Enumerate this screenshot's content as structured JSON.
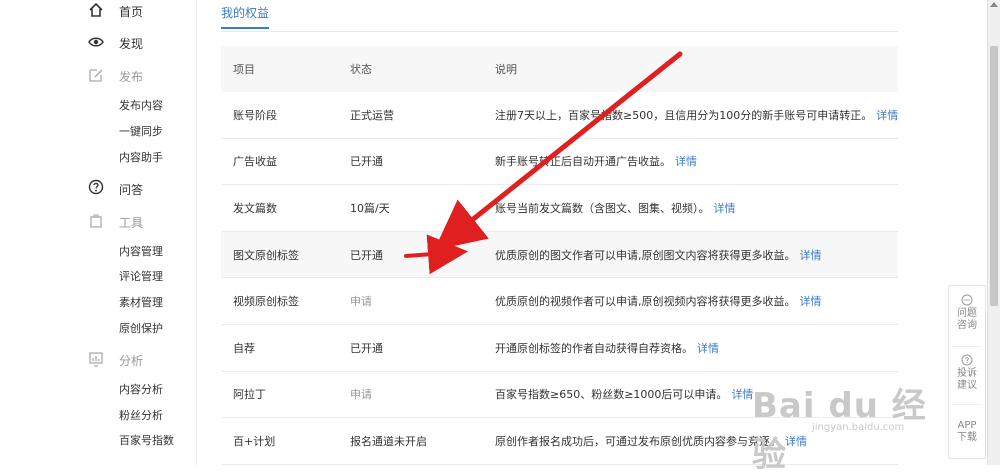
{
  "sidebar": {
    "home": "首页",
    "discover": "发现",
    "publish": "发布",
    "publish_items": [
      "发布内容",
      "一键同步",
      "内容助手"
    ],
    "qa": "问答",
    "tools": "工具",
    "tools_items": [
      "内容管理",
      "评论管理",
      "素材管理",
      "原创保护"
    ],
    "analysis": "分析",
    "analysis_items": [
      "内容分析",
      "粉丝分析",
      "百家号指数"
    ]
  },
  "main": {
    "tab_title": "我的权益",
    "table": {
      "headers": [
        "项目",
        "状态",
        "说明"
      ],
      "detail_label": "详情",
      "rows": [
        {
          "item": "账号阶段",
          "status": "正式运营",
          "desc": "注册7天以上，百家号指数≥500，且信用分为100分的新手账号可申请转正。"
        },
        {
          "item": "广告收益",
          "status": "已开通",
          "desc": "新手账号转正后自动开通广告收益。"
        },
        {
          "item": "发文篇数",
          "status": "10篇/天",
          "desc": "账号当前发文篇数（含图文、图集、视频）。"
        },
        {
          "item": "图文原创标签",
          "status": "已开通",
          "desc": "优质原创的图文作者可以申请,原创图文内容将获得更多收益。"
        },
        {
          "item": "视频原创标签",
          "status": "申请",
          "desc": "优质原创的视频作者可以申请,原创视频内容将获得更多收益。"
        },
        {
          "item": "自荐",
          "status": "已开通",
          "desc": "开通原创标签的作者自动获得自荐资格。"
        },
        {
          "item": "阿拉丁",
          "status": "申请",
          "desc": "百家号指数≥650、粉丝数≥1000后可以申请。"
        },
        {
          "item": "百+计划",
          "status": "报名通道未开启",
          "desc": "原创作者报名成功后，可通过发布原创优质内容参与竞逐。"
        }
      ]
    }
  },
  "float_tools": {
    "feedback": [
      "问题",
      "咨询"
    ],
    "report": [
      "投诉",
      "建议"
    ],
    "app": [
      "APP",
      "下载"
    ]
  },
  "watermark": {
    "brand": "Bai du 经验",
    "url": "jingyan.baidu.com"
  },
  "colors": {
    "link": "#3c7cc4",
    "arrow": "#e02020",
    "muted": "#999999"
  }
}
